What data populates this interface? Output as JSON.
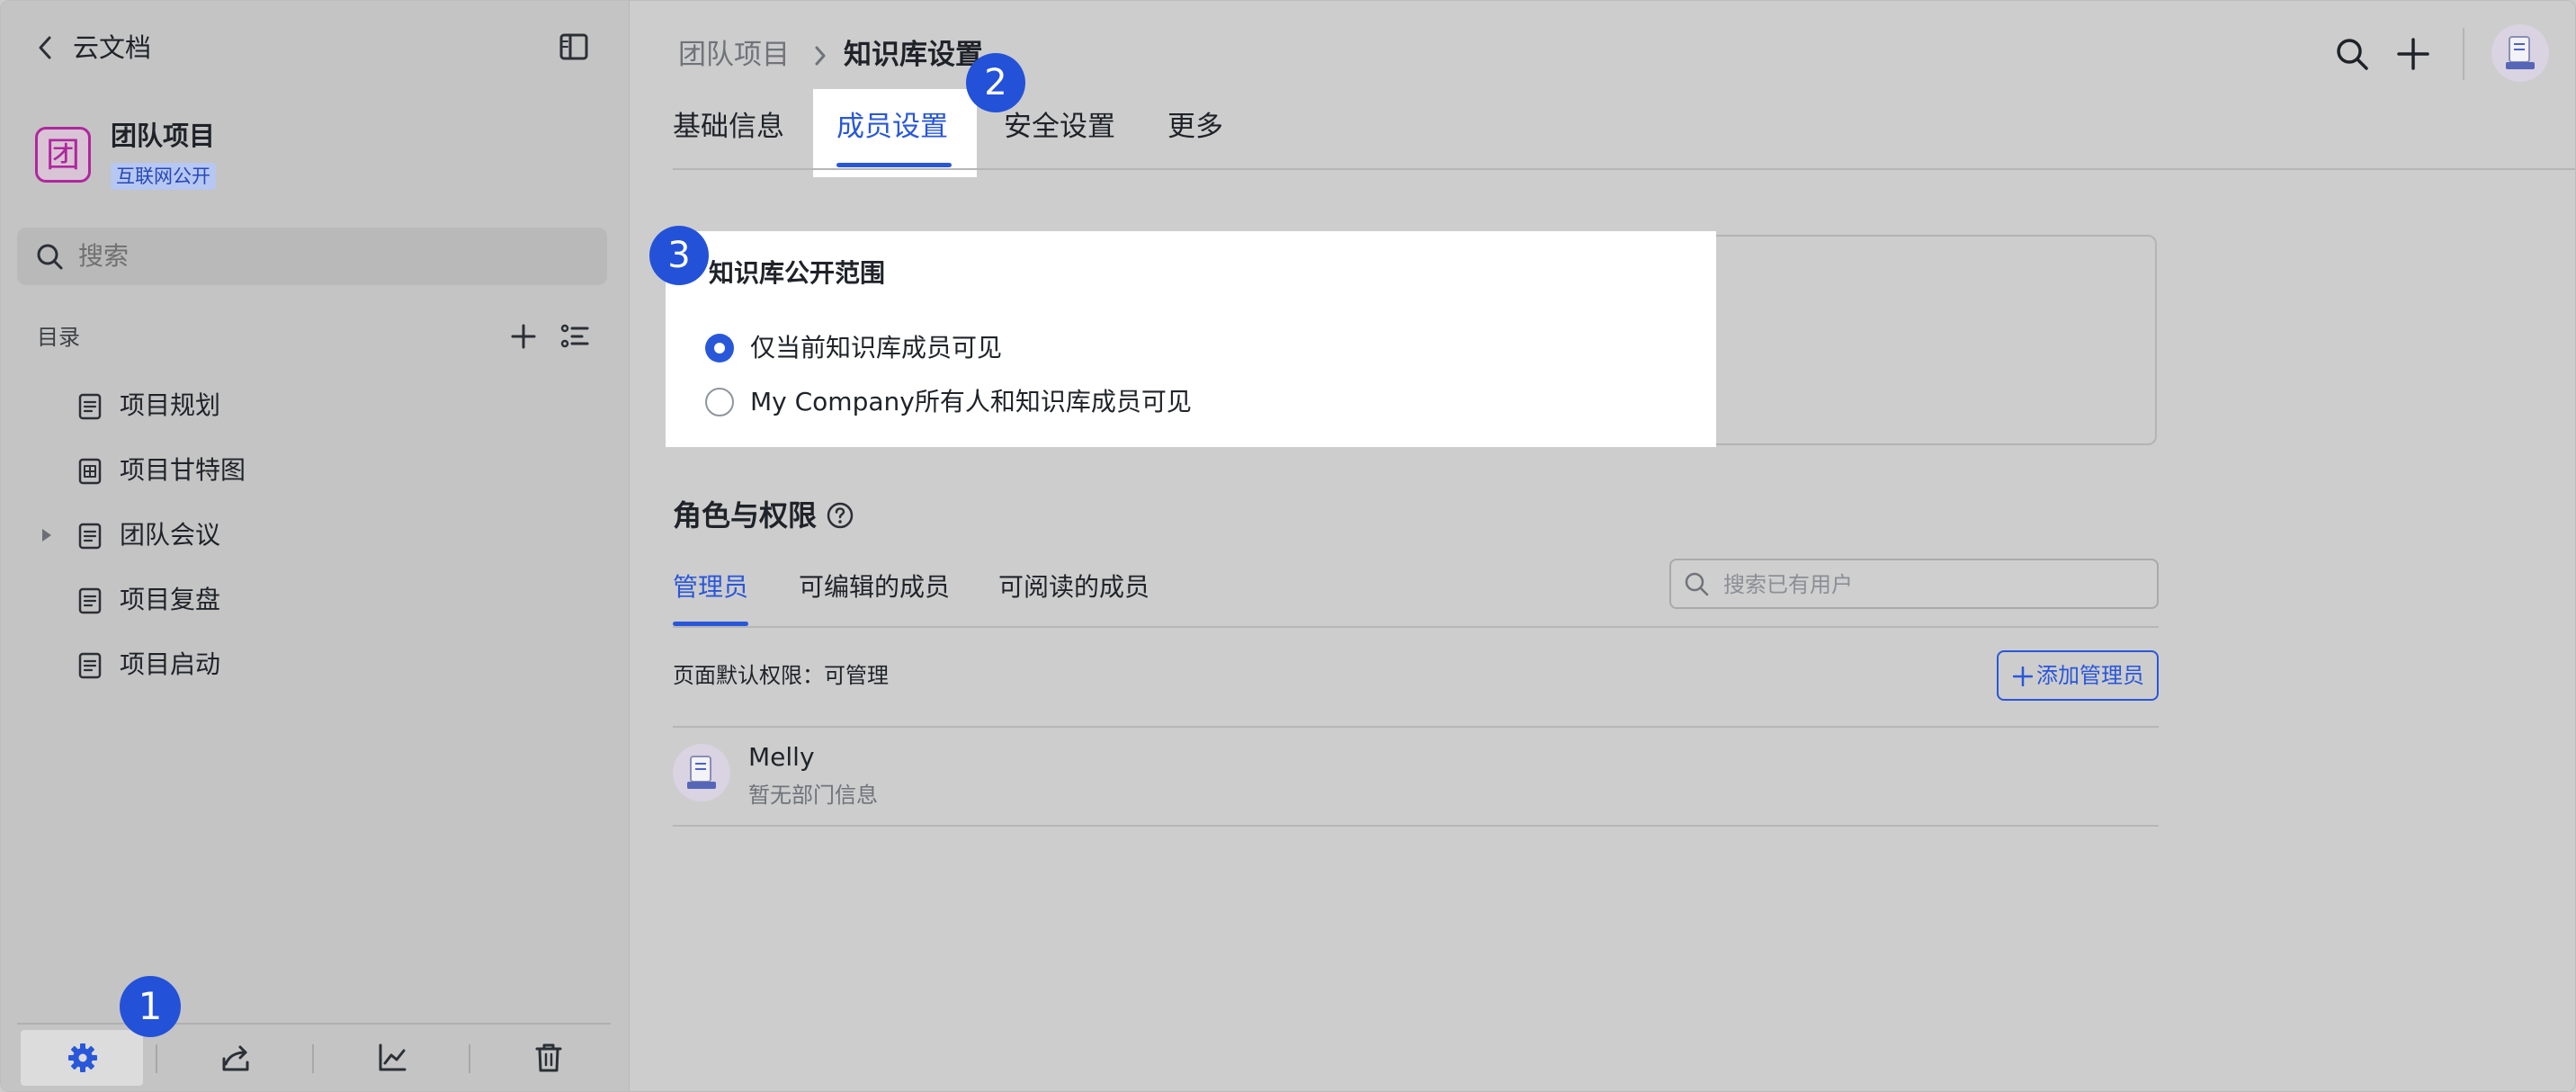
{
  "sidebar": {
    "back_label": "云文档",
    "space": {
      "avatar_char": "团",
      "name": "团队项目",
      "badge": "互联网公开"
    },
    "search_placeholder": "搜索",
    "catalog_label": "目录",
    "tree": [
      {
        "label": "项目规划",
        "icon": "doc-icon"
      },
      {
        "label": "项目甘特图",
        "icon": "table-icon"
      },
      {
        "label": "团队会议",
        "icon": "doc-icon"
      },
      {
        "label": "项目复盘",
        "icon": "doc-icon"
      },
      {
        "label": "项目启动",
        "icon": "doc-icon"
      }
    ],
    "footer_icons": [
      "gear-icon",
      "share-icon",
      "chart-icon",
      "trash-icon"
    ]
  },
  "header": {
    "breadcrumb_parent": "团队项目",
    "breadcrumb_current": "知识库设置"
  },
  "tabs": [
    {
      "label": "基础信息",
      "active": false
    },
    {
      "label": "成员设置",
      "active": true
    },
    {
      "label": "安全设置",
      "active": false
    },
    {
      "label": "更多",
      "active": false
    }
  ],
  "visibility": {
    "title": "知识库公开范围",
    "options": [
      {
        "label": "仅当前知识库成员可见",
        "selected": true
      },
      {
        "label": "My Company所有人和知识库成员可见",
        "selected": false
      }
    ]
  },
  "roles": {
    "title": "角色与权限",
    "tabs": [
      {
        "label": "管理员",
        "active": true
      },
      {
        "label": "可编辑的成员",
        "active": false
      },
      {
        "label": "可阅读的成员",
        "active": false
      }
    ],
    "search_placeholder": "搜索已有用户",
    "default_permission": "页面默认权限：可管理",
    "add_button": "添加管理员",
    "members": [
      {
        "name": "Melly",
        "dept": "暂无部门信息"
      }
    ]
  },
  "callouts": [
    "1",
    "2",
    "3"
  ],
  "colors": {
    "accent": "#2957d9",
    "callout": "#2352d8",
    "space_avatar": "#b0279f",
    "badge_bg": "#b7c7f3",
    "badge_text": "#2649b4"
  }
}
